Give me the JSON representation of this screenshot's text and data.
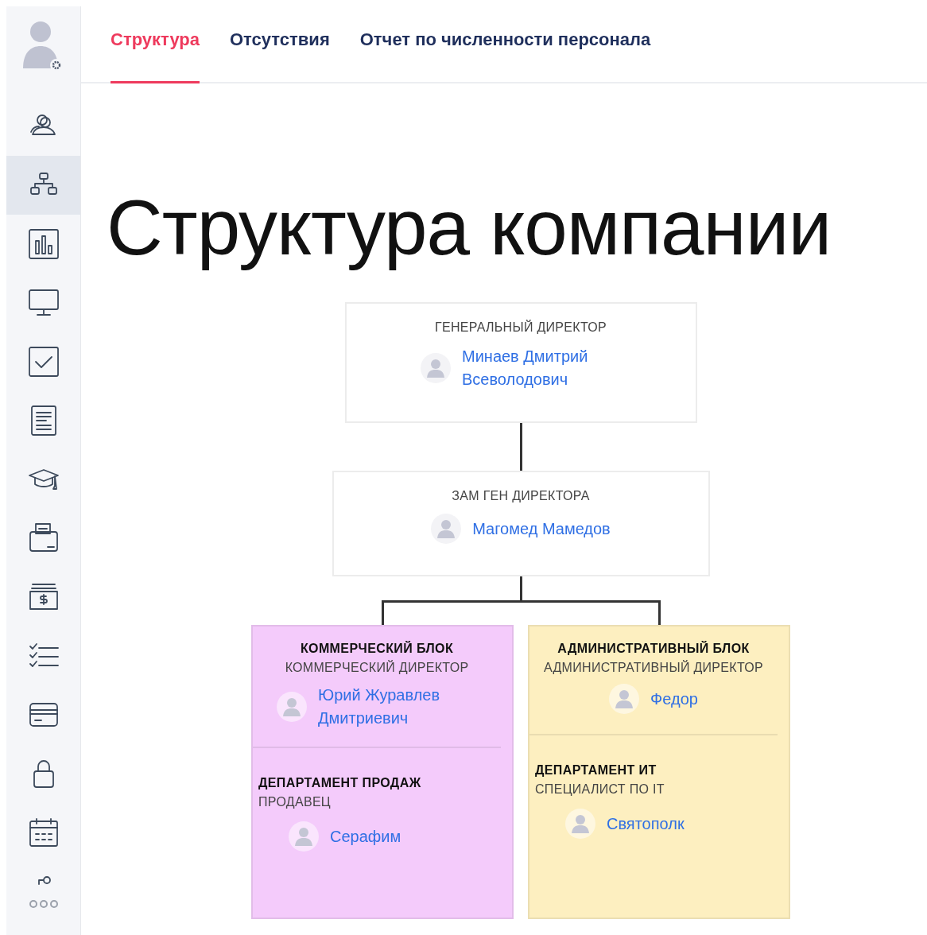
{
  "sidebar": {
    "items": [
      {
        "selected": false
      },
      {
        "selected": true
      },
      {
        "selected": false
      },
      {
        "selected": false
      },
      {
        "selected": false
      },
      {
        "selected": false
      },
      {
        "selected": false
      },
      {
        "selected": false
      },
      {
        "selected": false
      },
      {
        "selected": false
      },
      {
        "selected": false
      },
      {
        "selected": false
      },
      {
        "selected": false
      }
    ]
  },
  "tabs": [
    {
      "label": "Структура",
      "selected": true
    },
    {
      "label": "Отсутствия",
      "selected": false
    },
    {
      "label": "Отчет по численности персонала",
      "selected": false
    }
  ],
  "title": "Структура компании",
  "org_chart": {
    "top": [
      {
        "role": "ГЕНЕРАЛЬНЫЙ ДИРЕКТОР",
        "person": "Минаев Дмитрий Всеволодович"
      },
      {
        "role": "ЗАМ ГЕН ДИРЕКТОРА",
        "person": "Магомед Мамедов"
      }
    ],
    "blocks": [
      {
        "title": "КОММЕРЧЕСКИЙ БЛОК",
        "role": "КОММЕРЧЕСКИЙ ДИРЕКТОР",
        "person": "Юрий Журавлев Дмитриевич",
        "color": "#f4cbfb",
        "departments": [
          {
            "title": "ДЕПАРТАМЕНТ ПРОДАЖ",
            "role": "ПРОДАВЕЦ",
            "person": "Серафим"
          }
        ]
      },
      {
        "title": "АДМИНИСТРАТИВНЫЙ БЛОК",
        "role": "АДМИНИСТРАТИВНЫЙ ДИРЕКТОР",
        "person": "Федор",
        "color": "#fdefc0",
        "departments": [
          {
            "title": "ДЕПАРТАМЕНТ ИТ",
            "role": "СПЕЦИАЛИСТ ПО IT",
            "person": "Святополк"
          }
        ]
      }
    ]
  }
}
